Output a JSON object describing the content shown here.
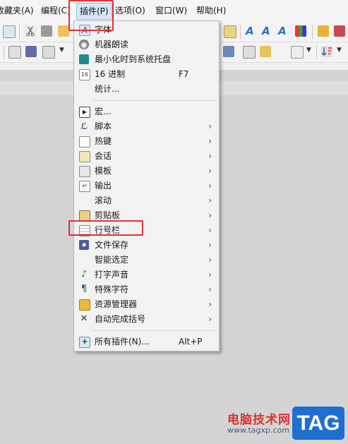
{
  "menubar": {
    "items": [
      {
        "label": "收藏夹(A)"
      },
      {
        "label": "编程(C)"
      },
      {
        "label": "插件(P)"
      },
      {
        "label": "选项(O)"
      },
      {
        "label": "窗口(W)"
      },
      {
        "label": "帮助(H)"
      }
    ]
  },
  "toolbar": {
    "style_letters": [
      "A",
      "A",
      "A"
    ]
  },
  "plugins_menu": {
    "items": [
      {
        "label": "字体",
        "icon": "font-icon"
      },
      {
        "label": "机器朗读",
        "icon": "speaker-icon"
      },
      {
        "label": "最小化时到系统托盘",
        "icon": "tray-icon"
      },
      {
        "label": "16 进制",
        "icon": "hex-icon",
        "shortcut": "F7"
      },
      {
        "label": "统计...",
        "icon": ""
      },
      {
        "label": "宏...",
        "icon": "macro-icon"
      },
      {
        "label": "脚本",
        "icon": "script-icon",
        "submenu": true
      },
      {
        "label": "热键",
        "icon": "hotkey-icon",
        "submenu": true
      },
      {
        "label": "会话",
        "icon": "session-icon",
        "submenu": true
      },
      {
        "label": "模板",
        "icon": "template-icon",
        "submenu": true
      },
      {
        "label": "输出",
        "icon": "output-icon",
        "submenu": true
      },
      {
        "label": "滚动",
        "icon": "",
        "submenu": true
      },
      {
        "label": "剪贴板",
        "icon": "clipboard-icon",
        "submenu": true
      },
      {
        "label": "行号栏",
        "icon": "line-number-icon",
        "submenu": true
      },
      {
        "label": "文件保存",
        "icon": "save-icon",
        "submenu": true
      },
      {
        "label": "智能选定",
        "icon": "",
        "submenu": true
      },
      {
        "label": "打字声音",
        "icon": "music-note-icon",
        "submenu": true
      },
      {
        "label": "特殊字符",
        "icon": "pilcrow-icon",
        "submenu": true
      },
      {
        "label": "资源管理器",
        "icon": "folder-icon",
        "submenu": true
      },
      {
        "label": "自动完成括号",
        "icon": "autocomplete-icon",
        "submenu": true
      },
      {
        "label": "所有插件(N)...",
        "icon": "plugins-icon",
        "shortcut": "Alt+P"
      }
    ],
    "submenu_arrow": "›"
  },
  "watermark": {
    "text": "电脑技术网",
    "url": "www.tagxp.com",
    "tag": "TAG"
  },
  "colors": {
    "highlight": "#e5322f",
    "menu_bg": "#f2f2f2",
    "accent": "#1e6fd1"
  }
}
